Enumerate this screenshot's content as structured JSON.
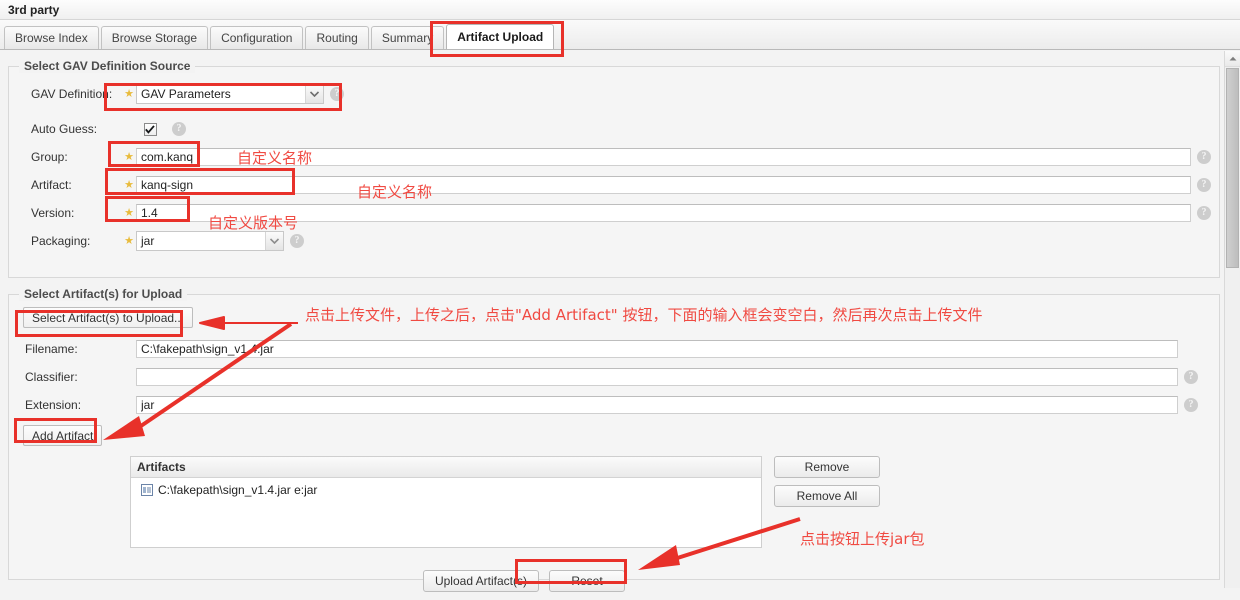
{
  "header": {
    "title": "3rd party"
  },
  "tabs": [
    {
      "label": "Browse Index",
      "active": false
    },
    {
      "label": "Browse Storage",
      "active": false
    },
    {
      "label": "Configuration",
      "active": false
    },
    {
      "label": "Routing",
      "active": false
    },
    {
      "label": "Summary",
      "active": false
    },
    {
      "label": "Artifact Upload",
      "active": true
    }
  ],
  "gav_section": {
    "legend": "Select GAV Definition Source",
    "gav_definition": {
      "label": "GAV Definition:",
      "value": "GAV Parameters"
    },
    "auto_guess": {
      "label": "Auto Guess:",
      "checked": true
    },
    "group": {
      "label": "Group:",
      "value": "com.kanq"
    },
    "artifact": {
      "label": "Artifact:",
      "value": "kanq-sign"
    },
    "version": {
      "label": "Version:",
      "value": "1.4"
    },
    "packaging": {
      "label": "Packaging:",
      "value": "jar"
    },
    "help_icon": "?"
  },
  "upload_section": {
    "legend": "Select Artifact(s) for Upload",
    "select_button": "Select Artifact(s) to Upload...",
    "filename": {
      "label": "Filename:",
      "value": "C:\\fakepath\\sign_v1.4.jar"
    },
    "classifier": {
      "label": "Classifier:",
      "value": ""
    },
    "extension": {
      "label": "Extension:",
      "value": "jar"
    },
    "add_artifact_button": "Add Artifact",
    "artifacts_header": "Artifacts",
    "artifacts": [
      {
        "name": "C:\\fakepath\\sign_v1.4.jar e:jar",
        "icon": "file-icon"
      }
    ],
    "remove_button": "Remove",
    "remove_all_button": "Remove All",
    "upload_button": "Upload Artifact(s)",
    "reset_button": "Reset"
  },
  "annotations": {
    "group_note": "自定义名称",
    "artifact_note": "自定义名称",
    "version_note": "自定义版本号",
    "upload_note": "点击上传文件，上传之后，点击\"Add Artifact\" 按钮，下面的输入框会变空白，然后再次点击上传文件",
    "upload_button_note": "点击按钮上传jar包"
  },
  "colors": {
    "annotation_red": "#e8312a",
    "annotation_text": "#f04a42",
    "required_star": "#e8bb3c"
  }
}
